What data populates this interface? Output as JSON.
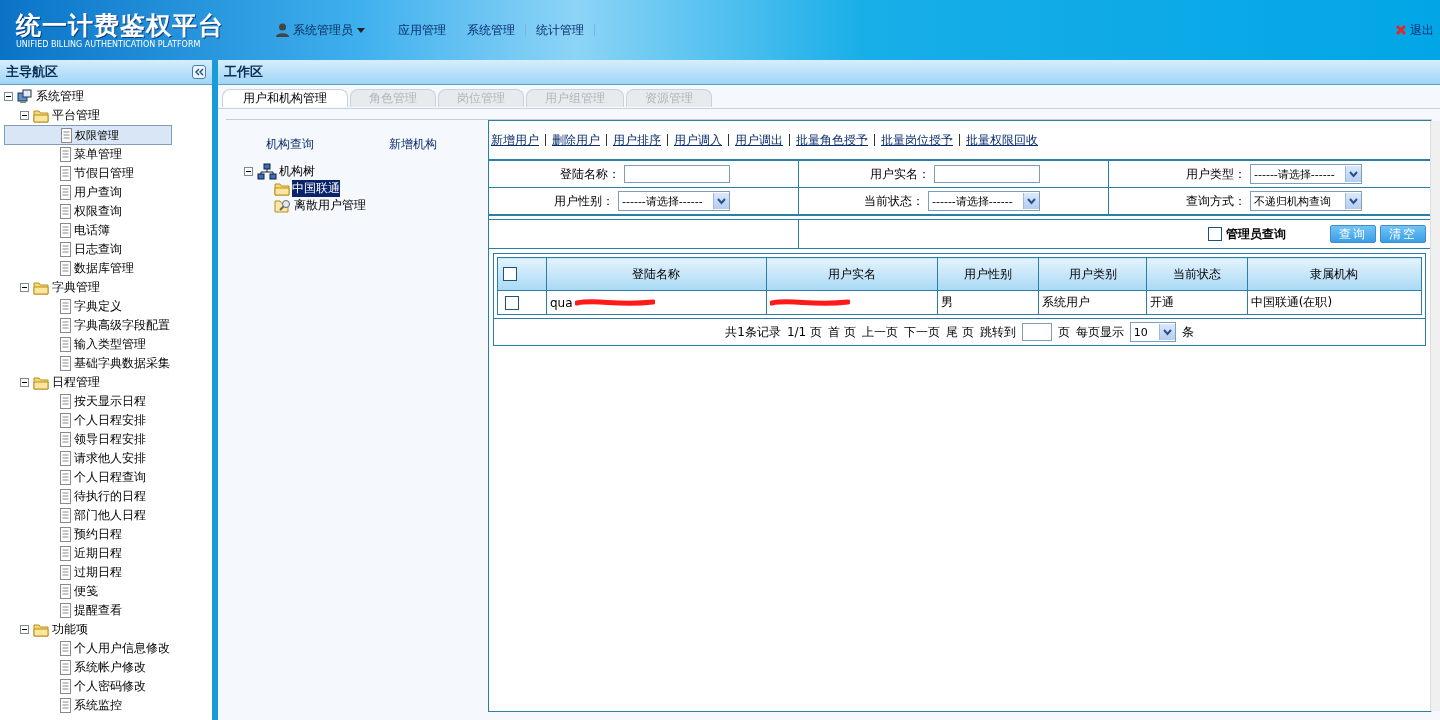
{
  "header": {
    "title": "统一计费鉴权平台",
    "subtitle": "UNIFIED BILLING AUTHENTICATION PLATFORM",
    "user": "系统管理员",
    "menu": [
      "应用管理",
      "系统管理",
      "统计管理"
    ],
    "logout": "退出"
  },
  "sidebar": {
    "title": "主导航区",
    "tree": [
      {
        "label": "系统管理",
        "kind": "root",
        "expanded": true,
        "children": [
          {
            "label": "平台管理",
            "kind": "folder",
            "expanded": true,
            "children": [
              {
                "label": "权限管理",
                "selected": true
              },
              {
                "label": "菜单管理",
                "selected": false
              },
              {
                "label": "节假日管理",
                "selected": false
              },
              {
                "label": "用户查询",
                "selected": false
              },
              {
                "label": "权限查询",
                "selected": false
              },
              {
                "label": "电话簿",
                "selected": false
              },
              {
                "label": "日志查询",
                "selected": false
              },
              {
                "label": "数据库管理",
                "selected": false
              }
            ]
          },
          {
            "label": "字典管理",
            "kind": "folder",
            "expanded": true,
            "children": [
              {
                "label": "字典定义",
                "selected": false
              },
              {
                "label": "字典高级字段配置",
                "selected": false
              },
              {
                "label": "输入类型管理",
                "selected": false
              },
              {
                "label": "基础字典数据采集",
                "selected": false
              }
            ]
          },
          {
            "label": "日程管理",
            "kind": "folder",
            "expanded": true,
            "children": [
              {
                "label": "按天显示日程",
                "selected": false
              },
              {
                "label": "个人日程安排",
                "selected": false
              },
              {
                "label": "领导日程安排",
                "selected": false
              },
              {
                "label": "请求他人安排",
                "selected": false
              },
              {
                "label": "个人日程查询",
                "selected": false
              },
              {
                "label": "待执行的日程",
                "selected": false
              },
              {
                "label": "部门他人日程",
                "selected": false
              },
              {
                "label": "预约日程",
                "selected": false
              },
              {
                "label": "近期日程",
                "selected": false
              },
              {
                "label": "过期日程",
                "selected": false
              },
              {
                "label": "便笺",
                "selected": false
              },
              {
                "label": "提醒查看",
                "selected": false
              }
            ]
          },
          {
            "label": "功能项",
            "kind": "folder",
            "expanded": true,
            "children": [
              {
                "label": "个人用户信息修改",
                "selected": false
              },
              {
                "label": "系统帐户修改",
                "selected": false
              },
              {
                "label": "个人密码修改",
                "selected": false
              },
              {
                "label": "系统监控",
                "selected": false
              }
            ]
          }
        ]
      }
    ]
  },
  "workarea": {
    "title": "工作区",
    "tabs": [
      {
        "label": "用户和机构管理",
        "selected": true
      },
      {
        "label": "角色管理",
        "selected": false
      },
      {
        "label": "岗位管理",
        "selected": false
      },
      {
        "label": "用户组管理",
        "selected": false
      },
      {
        "label": "资源管理",
        "selected": false
      }
    ],
    "org_links": [
      "机构查询",
      "新增机构"
    ],
    "org_tree": {
      "label": "机构树",
      "expanded": true,
      "children": [
        {
          "label": "中国联通",
          "kind": "folder",
          "selected": true
        },
        {
          "label": "离散用户管理",
          "kind": "search-folder",
          "selected": false
        }
      ]
    },
    "actions": [
      "新增用户",
      "删除用户",
      "用户排序",
      "用户调入",
      "用户调出",
      "批量角色授予",
      "批量岗位授予",
      "批量权限回收"
    ],
    "filters": [
      {
        "label": "登陆名称：",
        "kind": "text"
      },
      {
        "label": "用户实名：",
        "kind": "text"
      },
      {
        "label": "用户类型：",
        "kind": "select",
        "value": "------请选择------"
      },
      {
        "label": "用户性别：",
        "kind": "select",
        "value": "------请选择------"
      },
      {
        "label": "当前状态：",
        "kind": "select",
        "value": "------请选择------"
      },
      {
        "label": "查询方式：",
        "kind": "select",
        "value": "不递归机构查询"
      }
    ],
    "admin_query": {
      "label": "管理员查询",
      "checked": false
    },
    "buttons": [
      "查询",
      "清空"
    ],
    "table": {
      "all_checked": false,
      "columns": [
        "登陆名称",
        "用户实名",
        "用户性别",
        "用户类别",
        "当前状态",
        "隶属机构"
      ],
      "rows": [
        {
          "checked": false,
          "cells": [
            {
              "text": "qua",
              "redacted": true
            },
            {
              "redacted": true
            },
            {
              "text": "男"
            },
            {
              "text": "系统用户"
            },
            {
              "text": "开通"
            },
            {
              "text": "中国联通(在职)"
            }
          ]
        }
      ]
    },
    "pagination": {
      "summary": "共1条记录",
      "pages": "1/1 页",
      "first": "首 页",
      "prev": "上一页",
      "next": "下一页",
      "last": "尾 页",
      "jump": "跳转到",
      "page_unit": "页",
      "per_page": "每页显示",
      "per_page_value": "10",
      "per_page_unit": "条"
    }
  }
}
